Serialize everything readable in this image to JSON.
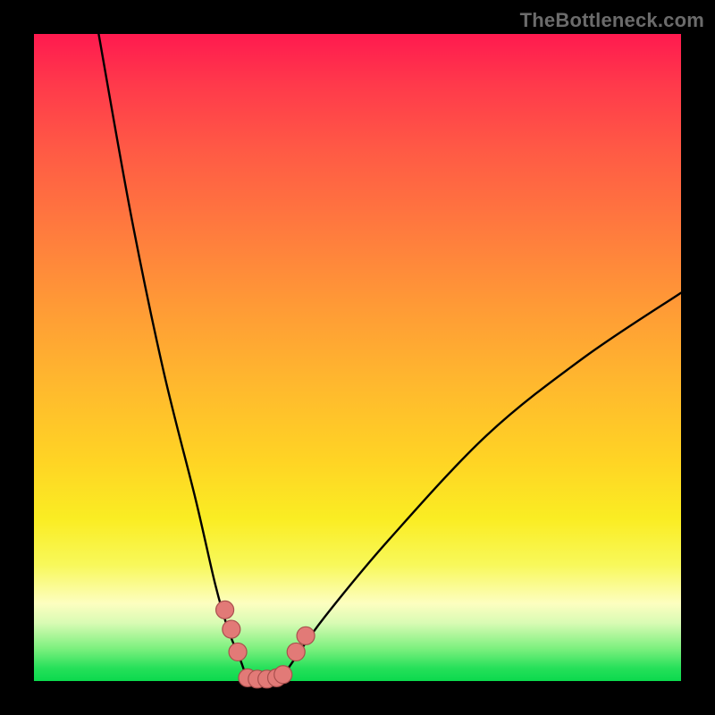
{
  "watermark": "TheBottleneck.com",
  "chart_data": {
    "type": "line",
    "title": "",
    "xlabel": "",
    "ylabel": "",
    "xlim": [
      0,
      100
    ],
    "ylim": [
      0,
      100
    ],
    "series": [
      {
        "name": "left-curve",
        "x": [
          10,
          15,
          20,
          25,
          28,
          30,
          32,
          33
        ],
        "values": [
          100,
          72,
          48,
          28,
          15,
          8,
          3,
          0
        ]
      },
      {
        "name": "valley-floor",
        "x": [
          33,
          38
        ],
        "values": [
          0,
          0
        ]
      },
      {
        "name": "right-curve",
        "x": [
          38,
          40,
          45,
          55,
          70,
          85,
          100
        ],
        "values": [
          0,
          3,
          10,
          22,
          38,
          50,
          60
        ]
      }
    ],
    "beads": {
      "left_cluster": [
        {
          "x": 29.5,
          "y": 11
        },
        {
          "x": 30.5,
          "y": 8
        },
        {
          "x": 31.5,
          "y": 4.5
        }
      ],
      "floor_cluster": [
        {
          "x": 33,
          "y": 0.5
        },
        {
          "x": 34.5,
          "y": 0.3
        },
        {
          "x": 36,
          "y": 0.3
        },
        {
          "x": 37.5,
          "y": 0.5
        },
        {
          "x": 38.5,
          "y": 1
        }
      ],
      "right_cluster": [
        {
          "x": 40.5,
          "y": 4.5
        },
        {
          "x": 42,
          "y": 7
        }
      ]
    },
    "colors": {
      "top": "#ff1a4f",
      "mid": "#ffd424",
      "bottom": "#0bd94d",
      "bead_fill": "#e27a77",
      "bead_stroke": "#a94f4d",
      "curve": "#000000"
    }
  }
}
